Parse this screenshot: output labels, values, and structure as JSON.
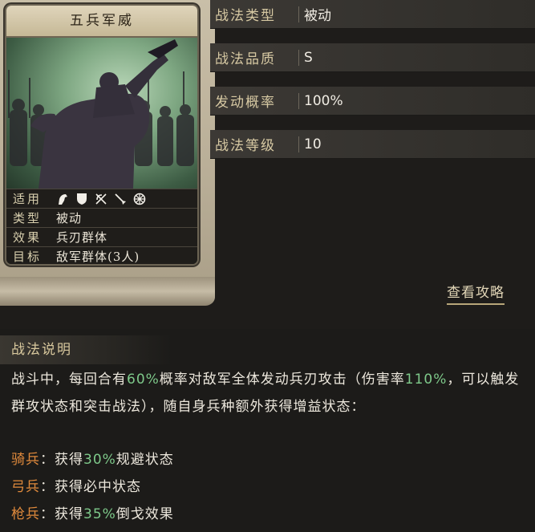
{
  "card": {
    "title": "五兵军威",
    "stats": [
      {
        "key": "适用",
        "value": ""
      },
      {
        "key": "类型",
        "value": "被动"
      },
      {
        "key": "效果",
        "value": "兵刃群体"
      },
      {
        "key": "目标",
        "value": "敌军群体(3人)"
      }
    ],
    "unit_icons": [
      "cavalry-icon",
      "shield-icon",
      "bow-icon",
      "spear-icon",
      "siege-icon"
    ]
  },
  "info": [
    {
      "key": "战法类型",
      "value": "被动"
    },
    {
      "key": "战法品质",
      "value": "S"
    },
    {
      "key": "发动概率",
      "value": "100%"
    },
    {
      "key": "战法等级",
      "value": "10"
    }
  ],
  "guide_link": "查看攻略",
  "description": {
    "title": "战法说明",
    "p1": "战斗中，每回合有",
    "p1_hl": "60%",
    "p2": "概率对敌军全体发动兵刃攻击（伤害率",
    "p3_hl": "110%",
    "p3": "，可以触发群攻状态和突击战法），随自身兵种额外获得增益状态：",
    "bullets": [
      {
        "tag": "骑兵",
        "pre": "获得",
        "hl": "30%",
        "post": "规避状态"
      },
      {
        "tag": "弓兵",
        "pre": "获得必中状态",
        "hl": "",
        "post": ""
      },
      {
        "tag": "枪兵",
        "pre": "获得",
        "hl": "35%",
        "post": "倒戈效果"
      }
    ]
  },
  "colors": {
    "highlight": "#7ec98a",
    "tag": "#e08a3c",
    "label": "#d7c9a3"
  }
}
